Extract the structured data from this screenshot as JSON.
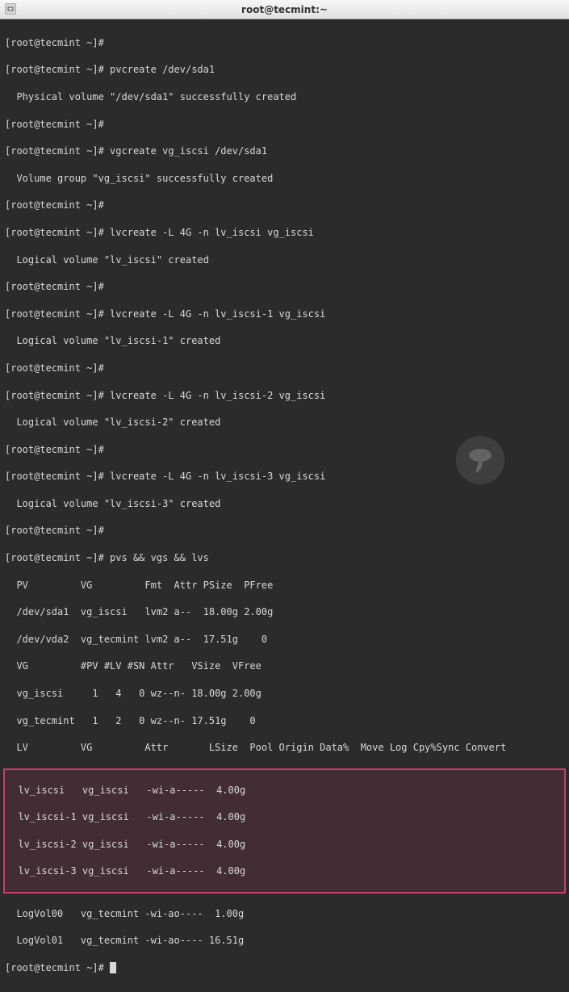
{
  "titlebar": {
    "title": "root@tecmint:~"
  },
  "prompt": "[root@tecmint ~]#",
  "lines": {
    "l0": "[root@tecmint ~]# ",
    "l1": "[root@tecmint ~]# pvcreate /dev/sda1",
    "l2": "  Physical volume \"/dev/sda1\" successfully created",
    "l3": "[root@tecmint ~]# ",
    "l4": "[root@tecmint ~]# vgcreate vg_iscsi /dev/sda1",
    "l5": "  Volume group \"vg_iscsi\" successfully created",
    "l6": "[root@tecmint ~]# ",
    "l7": "[root@tecmint ~]# lvcreate -L 4G -n lv_iscsi vg_iscsi",
    "l8": "  Logical volume \"lv_iscsi\" created",
    "l9": "[root@tecmint ~]# ",
    "l10": "[root@tecmint ~]# lvcreate -L 4G -n lv_iscsi-1 vg_iscsi",
    "l11": "  Logical volume \"lv_iscsi-1\" created",
    "l12": "[root@tecmint ~]# ",
    "l13": "[root@tecmint ~]# lvcreate -L 4G -n lv_iscsi-2 vg_iscsi",
    "l14": "  Logical volume \"lv_iscsi-2\" created",
    "l15": "[root@tecmint ~]# ",
    "l16": "[root@tecmint ~]# lvcreate -L 4G -n lv_iscsi-3 vg_iscsi",
    "l17": "  Logical volume \"lv_iscsi-3\" created",
    "l18": "[root@tecmint ~]# ",
    "l19": "[root@tecmint ~]# pvs && vgs && lvs",
    "l20": "  PV         VG         Fmt  Attr PSize  PFree",
    "l21": "  /dev/sda1  vg_iscsi   lvm2 a--  18.00g 2.00g",
    "l22": "  /dev/vda2  vg_tecmint lvm2 a--  17.51g    0 ",
    "l23": "  VG         #PV #LV #SN Attr   VSize  VFree",
    "l24": "  vg_iscsi     1   4   0 wz--n- 18.00g 2.00g",
    "l25": "  vg_tecmint   1   2   0 wz--n- 17.51g    0 ",
    "l26": "  LV         VG         Attr       LSize  Pool Origin Data%  Move Log Cpy%Sync Convert",
    "l27": "  lv_iscsi   vg_iscsi   -wi-a-----  4.00g",
    "l28": "  lv_iscsi-1 vg_iscsi   -wi-a-----  4.00g",
    "l29": "  lv_iscsi-2 vg_iscsi   -wi-a-----  4.00g",
    "l30": "  lv_iscsi-3 vg_iscsi   -wi-a-----  4.00g",
    "l31": "  LogVol00   vg_tecmint -wi-ao----  1.00g",
    "l32": "  LogVol01   vg_tecmint -wi-ao---- 16.51g",
    "l33": "[root@tecmint ~]# "
  }
}
